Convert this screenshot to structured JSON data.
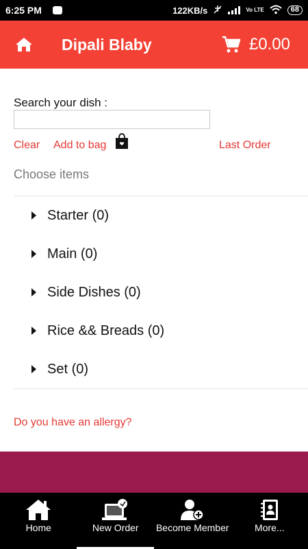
{
  "status_bar": {
    "time": "6:25 PM",
    "speed": "122KB/s",
    "network": "Vo LTE",
    "battery": "68"
  },
  "header": {
    "title": "Dipali Blaby",
    "cart_total": "£0.00",
    "icons": [
      "home-icon",
      "cart-icon"
    ],
    "background": "#f34235"
  },
  "search": {
    "label": "Search your dish :",
    "value": "",
    "placeholder": ""
  },
  "actions": {
    "clear": "Clear",
    "add_to_bag": "Add to bag",
    "last_order": "Last Order"
  },
  "section_title": "Choose items",
  "categories": [
    {
      "label": "Starter (0)"
    },
    {
      "label": "Main (0)"
    },
    {
      "label": "Side Dishes (0)"
    },
    {
      "label": "Rice && Breads (0)"
    },
    {
      "label": "Set (0)"
    }
  ],
  "allergy_link": "Do you have an allergy?",
  "bottom_nav": {
    "items": [
      {
        "label": "Home",
        "icon": "home-icon"
      },
      {
        "label": "New Order",
        "icon": "new-order-icon"
      },
      {
        "label": "Become Member",
        "icon": "add-member-icon"
      },
      {
        "label": "More...",
        "icon": "contacts-book-icon"
      }
    ]
  },
  "colors": {
    "accent": "#f34235",
    "link": "#e53935",
    "banner": "#9a1a4e"
  }
}
